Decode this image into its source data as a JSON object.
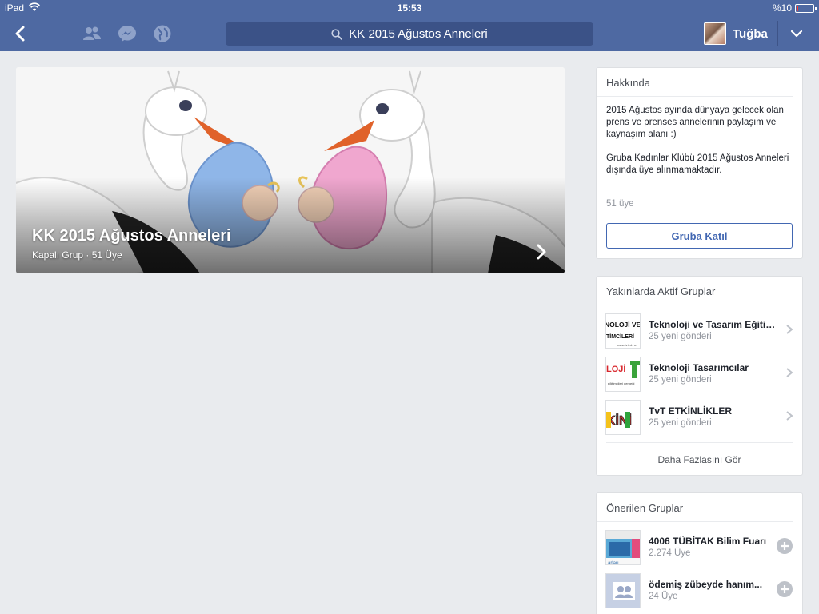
{
  "status_bar": {
    "device": "iPad",
    "time": "15:53",
    "battery": "%10",
    "battery_level": 0.1
  },
  "nav": {
    "search_text": "KK 2015 Ağustos Anneleri",
    "user_name": "Tuğba",
    "icons": [
      "back-icon",
      "friend-requests-icon",
      "messenger-icon",
      "notifications-globe-icon",
      "search-icon",
      "chevron-down-icon"
    ]
  },
  "cover": {
    "title": "KK 2015 Ağustos Anneleri",
    "subtitle": "Kapalı Grup · 51 Üye"
  },
  "about": {
    "header": "Hakkında",
    "text": "2015 Ağustos ayında dünyaya gelecek olan prens ve prenses annelerinin paylaşım ve kaynaşım alanı :)\n\nGruba Kadınlar Klübü 2015 Ağustos Anneleri  dışında üye alınmamaktadır.",
    "members": "51 üye",
    "join_label": "Gruba Katıl"
  },
  "nearby": {
    "header": "Yakınlarda Aktif Gruplar",
    "items": [
      {
        "name": "Teknoloji ve Tasarım Eğitimcileri",
        "meta": "25 yeni gönderi",
        "thumb_text": "NOLOJİ VE TİMCİLERİ"
      },
      {
        "name": "Teknoloji Tasarımcılar",
        "meta": "25 yeni gönderi",
        "thumb_text": "LOJİ"
      },
      {
        "name": "TvT ETKİNLİKLER",
        "meta": "25 yeni gönderi",
        "thumb_text": "KİNİ"
      }
    ],
    "more_label": "Daha Fazlasını Gör"
  },
  "suggested": {
    "header": "Önerilen Gruplar",
    "items": [
      {
        "name": "4006 TÜBİTAK Bilim Fuarı",
        "meta": "2.274 Üye"
      },
      {
        "name": "ödemiş zübeyde hanım...",
        "meta": "24 Üye"
      }
    ]
  },
  "colors": {
    "navbar": "#4e69a2",
    "background": "#e9ebee",
    "accent": "#4267b2"
  }
}
